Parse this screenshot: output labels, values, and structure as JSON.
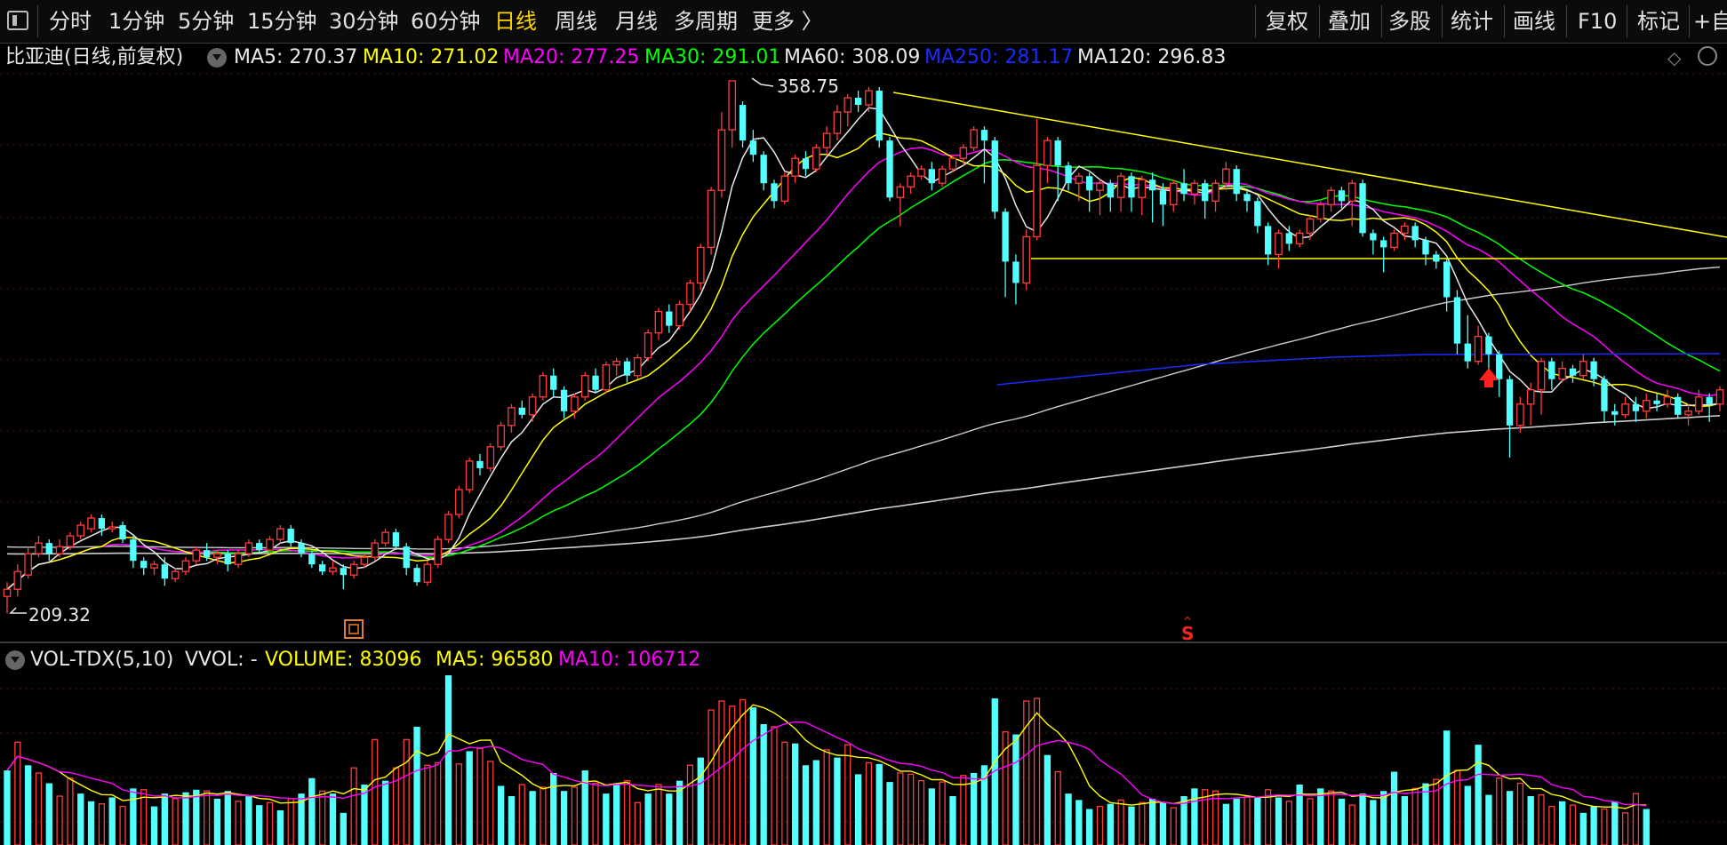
{
  "toolbar": {
    "items": [
      "分时",
      "1分钟",
      "5分钟",
      "15分钟",
      "30分钟",
      "60分钟",
      "日线",
      "周线",
      "月线",
      "多周期",
      "更多 〉"
    ],
    "active_index": 6,
    "right_items": [
      "复权",
      "叠加",
      "多股",
      "统计",
      "画线",
      "F10",
      "标记",
      "+自"
    ]
  },
  "main_header": {
    "title": "比亚迪(日线,前复权)",
    "indicators": [
      {
        "label": "MA5: 270.37",
        "color": "#e8e8e8"
      },
      {
        "label": "MA10: 271.02",
        "color": "#ffff00"
      },
      {
        "label": "MA20: 277.25",
        "color": "#ff00ff"
      },
      {
        "label": "MA30: 291.01",
        "color": "#00ff00"
      },
      {
        "label": "MA60: 308.09",
        "color": "#e8e8e8"
      },
      {
        "label": "MA250: 281.17",
        "color": "#1a2bff"
      },
      {
        "label": "MA120: 296.83",
        "color": "#e8e8e8"
      }
    ]
  },
  "annotations": {
    "high": "358.75",
    "low": "209.32",
    "signal": "S"
  },
  "vol_header": {
    "name": "VOL-TDX(5,10)",
    "vvol": "VVOL: -",
    "volume": "VOLUME: 83096",
    "ma5": "MA5: 96580",
    "ma10": "MA10: 106712"
  },
  "colors": {
    "up": "#ff3c3c",
    "down": "#54ffff",
    "ma5": "#e8e8e8",
    "ma10": "#ffff00",
    "ma20": "#ff00ff",
    "ma30": "#00ff00",
    "ma60": "#cccccc",
    "ma250": "#1a2bff",
    "ma120": "#cccccc",
    "trend": "#ffff00"
  },
  "chart_data": {
    "type": "candlestick",
    "price_range": [
      209.32,
      358.75
    ],
    "candles": [
      [
        214,
        216,
        218,
        209.3
      ],
      [
        216,
        221,
        223,
        214
      ],
      [
        220,
        226,
        228,
        219
      ],
      [
        226,
        229,
        231,
        225
      ],
      [
        229,
        226,
        230,
        224
      ],
      [
        226,
        228,
        230,
        225
      ],
      [
        228,
        231,
        232,
        227
      ],
      [
        231,
        234,
        235,
        230
      ],
      [
        233,
        236,
        237,
        232
      ],
      [
        236,
        233,
        237,
        231
      ],
      [
        233,
        233.5,
        235,
        232
      ],
      [
        234,
        230,
        235,
        229
      ],
      [
        230,
        224,
        231,
        222
      ],
      [
        224,
        222,
        225,
        220
      ],
      [
        222,
        223,
        224,
        220
      ],
      [
        223,
        219,
        225,
        217
      ],
      [
        219,
        221,
        222,
        218
      ],
      [
        221,
        224,
        225,
        220
      ],
      [
        224,
        227,
        228,
        223
      ],
      [
        227,
        225,
        229,
        224
      ],
      [
        225,
        226,
        227,
        223
      ],
      [
        226,
        223,
        227,
        221
      ],
      [
        223,
        226,
        227,
        222
      ],
      [
        226,
        229,
        230,
        225
      ],
      [
        229,
        227,
        230,
        226
      ],
      [
        227,
        230,
        231,
        226
      ],
      [
        230,
        233,
        234,
        229
      ],
      [
        233,
        229,
        234,
        228
      ],
      [
        229,
        226,
        230,
        225
      ],
      [
        226,
        223,
        227,
        222
      ],
      [
        223,
        221,
        224,
        220
      ],
      [
        221,
        222,
        224,
        220
      ],
      [
        222,
        220,
        223,
        216
      ],
      [
        220,
        223,
        224,
        219
      ],
      [
        223,
        225,
        226,
        222
      ],
      [
        225,
        229,
        230,
        224
      ],
      [
        229,
        232,
        233,
        228
      ],
      [
        232,
        228,
        233,
        227
      ],
      [
        228,
        222,
        229,
        220
      ],
      [
        222,
        218,
        223,
        217
      ],
      [
        218,
        223,
        224,
        217
      ],
      [
        223,
        230,
        231,
        222
      ],
      [
        230,
        237,
        238,
        229
      ],
      [
        237,
        244,
        245,
        236
      ],
      [
        244,
        252,
        253,
        243
      ],
      [
        252,
        250,
        254,
        248
      ],
      [
        250,
        256,
        257,
        249
      ],
      [
        256,
        262,
        263,
        255
      ],
      [
        262,
        267,
        268,
        260
      ],
      [
        267,
        265,
        269,
        264
      ],
      [
        265,
        270,
        271,
        263
      ],
      [
        270,
        276,
        277,
        269
      ],
      [
        276,
        272,
        278,
        270
      ],
      [
        272,
        266,
        273,
        264
      ],
      [
        266,
        270,
        271,
        264
      ],
      [
        270,
        276,
        277,
        269
      ],
      [
        276,
        272,
        278,
        271
      ],
      [
        272,
        279,
        280,
        271
      ],
      [
        279,
        280,
        281,
        276
      ],
      [
        280,
        276,
        281,
        274
      ],
      [
        276,
        281,
        282,
        275
      ],
      [
        281,
        288,
        289,
        280
      ],
      [
        288,
        294,
        295,
        286
      ],
      [
        294,
        290,
        296,
        288
      ],
      [
        290,
        296,
        297,
        289
      ],
      [
        296,
        302,
        303,
        294
      ],
      [
        302,
        312,
        313,
        300
      ],
      [
        312,
        328,
        329,
        310
      ],
      [
        328,
        345,
        350,
        326
      ],
      [
        345,
        358.75,
        358.75,
        340
      ],
      [
        352,
        342,
        353,
        340
      ],
      [
        342,
        338,
        345,
        336
      ],
      [
        338,
        330,
        339,
        328
      ],
      [
        330,
        325,
        331,
        323
      ],
      [
        325,
        332,
        333,
        324
      ],
      [
        332,
        337,
        338,
        330
      ],
      [
        337,
        334,
        339,
        332
      ],
      [
        334,
        340,
        341,
        333
      ],
      [
        340,
        344,
        346,
        338
      ],
      [
        344,
        350,
        352,
        342
      ],
      [
        350,
        354,
        355,
        346
      ],
      [
        354,
        352,
        356,
        350
      ],
      [
        352,
        356,
        357,
        350
      ],
      [
        356,
        342,
        357,
        340
      ],
      [
        342,
        326,
        343,
        325
      ],
      [
        326,
        329,
        330,
        318
      ],
      [
        329,
        332,
        333,
        327
      ],
      [
        332,
        334,
        335,
        331
      ],
      [
        334,
        330,
        336,
        328
      ],
      [
        330,
        334,
        335,
        329
      ],
      [
        334,
        337,
        338,
        333
      ],
      [
        337,
        340,
        341,
        335
      ],
      [
        340,
        345,
        346,
        339
      ],
      [
        345,
        342,
        346,
        330
      ],
      [
        342,
        322,
        343,
        320
      ],
      [
        322,
        308,
        323,
        298
      ],
      [
        308,
        302,
        310,
        296
      ],
      [
        302,
        315,
        317,
        300
      ],
      [
        315,
        335,
        348,
        314
      ],
      [
        335,
        342,
        343,
        330
      ],
      [
        342,
        335,
        343,
        325
      ],
      [
        335,
        330,
        336,
        328
      ],
      [
        330,
        332,
        333,
        325
      ],
      [
        332,
        328,
        333,
        322
      ],
      [
        328,
        330,
        331,
        321
      ],
      [
        330,
        326,
        331,
        322
      ],
      [
        326,
        332,
        333,
        322
      ],
      [
        332,
        326,
        333,
        322
      ],
      [
        326,
        331,
        332,
        321
      ],
      [
        331,
        328,
        333,
        319
      ],
      [
        328,
        324,
        330,
        318
      ],
      [
        324,
        330,
        331,
        322
      ],
      [
        330,
        327,
        334,
        325
      ],
      [
        327,
        330,
        331,
        324
      ],
      [
        330,
        325,
        331,
        320
      ],
      [
        325,
        330,
        331,
        322
      ],
      [
        330,
        334,
        336,
        328
      ],
      [
        334,
        327,
        335,
        325
      ],
      [
        327,
        325,
        328,
        322
      ],
      [
        325,
        318,
        326,
        316
      ],
      [
        318,
        310,
        319,
        307
      ],
      [
        310,
        316,
        317,
        306
      ],
      [
        316,
        313,
        318,
        311
      ],
      [
        313,
        316,
        317,
        312
      ],
      [
        316,
        320,
        321,
        314
      ],
      [
        320,
        324,
        325,
        319
      ],
      [
        324,
        328,
        329,
        322
      ],
      [
        328,
        325,
        329,
        323
      ],
      [
        325,
        330,
        331,
        318
      ],
      [
        330,
        316,
        331,
        315
      ],
      [
        316,
        314,
        317,
        310
      ],
      [
        314,
        312,
        315,
        305
      ],
      [
        312,
        316,
        317,
        311
      ],
      [
        316,
        318,
        319,
        314
      ],
      [
        318,
        314,
        319,
        312
      ],
      [
        314,
        310,
        315,
        307
      ],
      [
        310,
        308,
        311,
        306
      ],
      [
        308,
        298,
        309,
        294
      ],
      [
        298,
        285,
        300,
        282
      ],
      [
        285,
        280,
        293,
        278
      ],
      [
        280,
        287,
        290,
        279
      ],
      [
        287,
        282,
        288,
        275
      ],
      [
        282,
        275,
        283,
        270
      ],
      [
        275,
        262,
        276,
        253
      ],
      [
        262,
        268,
        270,
        260
      ],
      [
        268,
        272,
        274,
        262
      ],
      [
        272,
        280,
        281,
        265
      ],
      [
        280,
        275,
        281,
        272
      ],
      [
        275,
        278,
        280,
        274
      ],
      [
        278,
        276,
        279,
        274
      ],
      [
        276,
        280,
        282,
        275
      ],
      [
        280,
        275,
        281,
        273
      ],
      [
        275,
        266,
        276,
        263
      ],
      [
        266,
        265,
        268,
        262
      ],
      [
        265,
        268,
        270,
        264
      ],
      [
        268,
        266,
        270,
        263
      ],
      [
        266,
        269,
        271,
        264
      ],
      [
        269,
        268,
        271,
        266
      ],
      [
        268,
        270,
        272,
        267
      ],
      [
        270,
        265,
        271,
        264
      ],
      [
        265,
        266,
        268,
        262
      ],
      [
        266,
        270,
        272,
        265
      ],
      [
        270,
        268,
        271,
        263
      ],
      [
        268,
        272,
        273,
        266
      ]
    ],
    "volumes": [
      [
        58,
        1
      ],
      [
        80,
        0
      ],
      [
        62,
        1
      ],
      [
        56,
        0
      ],
      [
        48,
        1
      ],
      [
        38,
        0
      ],
      [
        52,
        0
      ],
      [
        40,
        1
      ],
      [
        34,
        1
      ],
      [
        32,
        0
      ],
      [
        37,
        1
      ],
      [
        30,
        0
      ],
      [
        44,
        1
      ],
      [
        43,
        0
      ],
      [
        30,
        1
      ],
      [
        40,
        1
      ],
      [
        36,
        0
      ],
      [
        41,
        1
      ],
      [
        43,
        1
      ],
      [
        42,
        0
      ],
      [
        36,
        1
      ],
      [
        42,
        1
      ],
      [
        34,
        0
      ],
      [
        38,
        1
      ],
      [
        31,
        1
      ],
      [
        33,
        0
      ],
      [
        27,
        1
      ],
      [
        36,
        0
      ],
      [
        40,
        1
      ],
      [
        52,
        1
      ],
      [
        42,
        0
      ],
      [
        40,
        1
      ],
      [
        25,
        1
      ],
      [
        60,
        0
      ],
      [
        47,
        1
      ],
      [
        82,
        0
      ],
      [
        50,
        1
      ],
      [
        60,
        0
      ],
      [
        82,
        0
      ],
      [
        92,
        1
      ],
      [
        62,
        0
      ],
      [
        64,
        0
      ],
      [
        132,
        1
      ],
      [
        63,
        0
      ],
      [
        73,
        1
      ],
      [
        75,
        0
      ],
      [
        65,
        0
      ],
      [
        46,
        1
      ],
      [
        38,
        1
      ],
      [
        47,
        0
      ],
      [
        42,
        1
      ],
      [
        45,
        0
      ],
      [
        56,
        1
      ],
      [
        42,
        1
      ],
      [
        45,
        0
      ],
      [
        58,
        1
      ],
      [
        48,
        0
      ],
      [
        40,
        1
      ],
      [
        48,
        1
      ],
      [
        50,
        0
      ],
      [
        33,
        0
      ],
      [
        40,
        1
      ],
      [
        47,
        0
      ],
      [
        40,
        1
      ],
      [
        50,
        1
      ],
      [
        62,
        0
      ],
      [
        68,
        1
      ],
      [
        105,
        0
      ],
      [
        112,
        0
      ],
      [
        108,
        0
      ],
      [
        113,
        0
      ],
      [
        107,
        1
      ],
      [
        94,
        1
      ],
      [
        92,
        0
      ],
      [
        80,
        0
      ],
      [
        79,
        1
      ],
      [
        62,
        1
      ],
      [
        66,
        1
      ],
      [
        74,
        0
      ],
      [
        68,
        1
      ],
      [
        78,
        0
      ],
      [
        55,
        1
      ],
      [
        64,
        0
      ],
      [
        63,
        1
      ],
      [
        49,
        1
      ],
      [
        56,
        0
      ],
      [
        55,
        0
      ],
      [
        50,
        0
      ],
      [
        44,
        1
      ],
      [
        49,
        0
      ],
      [
        38,
        1
      ],
      [
        54,
        0
      ],
      [
        56,
        1
      ],
      [
        62,
        1
      ],
      [
        114,
        1
      ],
      [
        88,
        0
      ],
      [
        86,
        1
      ],
      [
        112,
        0
      ],
      [
        114,
        0
      ],
      [
        70,
        1
      ],
      [
        57,
        0
      ],
      [
        40,
        1
      ],
      [
        35,
        1
      ],
      [
        28,
        1
      ],
      [
        30,
        0
      ],
      [
        32,
        1
      ],
      [
        35,
        0
      ],
      [
        30,
        1
      ],
      [
        33,
        0
      ],
      [
        36,
        1
      ],
      [
        33,
        1
      ],
      [
        29,
        0
      ],
      [
        38,
        1
      ],
      [
        44,
        1
      ],
      [
        43,
        0
      ],
      [
        42,
        0
      ],
      [
        32,
        1
      ],
      [
        36,
        1
      ],
      [
        38,
        0
      ],
      [
        37,
        1
      ],
      [
        43,
        0
      ],
      [
        37,
        1
      ],
      [
        34,
        0
      ],
      [
        47,
        1
      ],
      [
        36,
        0
      ],
      [
        44,
        1
      ],
      [
        42,
        0
      ],
      [
        36,
        1
      ],
      [
        31,
        0
      ],
      [
        40,
        1
      ],
      [
        35,
        1
      ],
      [
        42,
        1
      ],
      [
        57,
        1
      ],
      [
        38,
        1
      ],
      [
        44,
        0
      ],
      [
        48,
        1
      ],
      [
        51,
        0
      ],
      [
        89,
        1
      ],
      [
        58,
        0
      ],
      [
        46,
        1
      ],
      [
        78,
        1
      ],
      [
        39,
        1
      ],
      [
        52,
        0
      ],
      [
        42,
        1
      ],
      [
        48,
        0
      ],
      [
        38,
        1
      ],
      [
        39,
        0
      ],
      [
        30,
        0
      ],
      [
        34,
        1
      ],
      [
        31,
        0
      ],
      [
        25,
        1
      ],
      [
        30,
        1
      ],
      [
        28,
        0
      ],
      [
        34,
        1
      ],
      [
        25,
        0
      ],
      [
        40,
        0
      ],
      [
        28,
        1
      ]
    ]
  }
}
